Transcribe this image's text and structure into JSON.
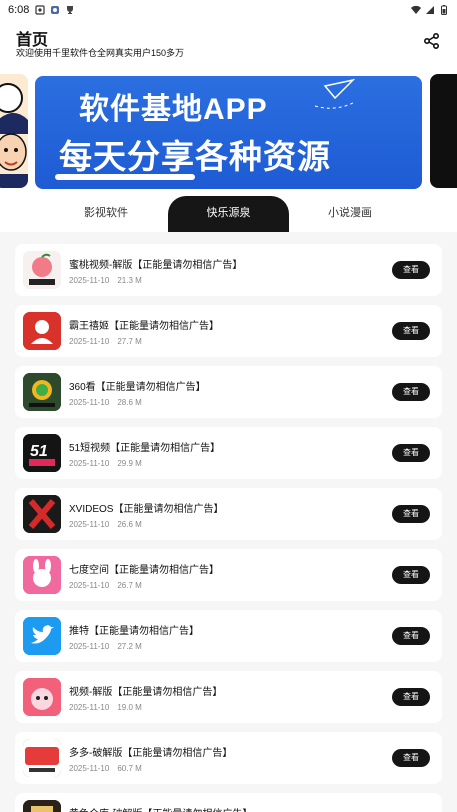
{
  "status": {
    "time": "6:08"
  },
  "header": {
    "title": "首页",
    "subtitle": "欢迎使用千里软件仓全网真实用户150多万"
  },
  "banner": {
    "line1": "软件基地APP",
    "line2": "每天分享各种资源"
  },
  "tabs": [
    {
      "label": "影视软件",
      "active": false
    },
    {
      "label": "快乐源泉",
      "active": true
    },
    {
      "label": "小说漫画",
      "active": false
    }
  ],
  "apps": [
    {
      "name": "蜜桃视频-解版【正能量请勿相信广告】",
      "date": "2025-11-10",
      "size": "21.3 M",
      "button": "查看",
      "icon": "peach-app-icon",
      "color": "#f7f0f0"
    },
    {
      "name": "霸王禧姬【正能量请勿相信广告】",
      "date": "2025-11-10",
      "size": "27.7 M",
      "button": "查看",
      "icon": "bawang-app-icon",
      "color": "#d8322a"
    },
    {
      "name": "360看【正能量请勿相信广告】",
      "date": "2025-11-10",
      "size": "28.6 M",
      "button": "查看",
      "icon": "360-app-icon",
      "color": "#2e4a2c"
    },
    {
      "name": "51短视频【正能量请勿相信广告】",
      "date": "2025-11-10",
      "size": "29.9 M",
      "button": "查看",
      "icon": "51-app-icon",
      "color": "#141414"
    },
    {
      "name": "XVIDEOS【正能量请勿相信广告】",
      "date": "2025-11-10",
      "size": "26.6 M",
      "button": "查看",
      "icon": "xvideos-app-icon",
      "color": "#1a1a1a"
    },
    {
      "name": "七度空间【正能量请勿相信广告】",
      "date": "2025-11-10",
      "size": "26.7 M",
      "button": "查看",
      "icon": "qidu-app-icon",
      "color": "#f06aa0"
    },
    {
      "name": "推特【正能量请勿相信广告】",
      "date": "2025-11-10",
      "size": "27.2 M",
      "button": "查看",
      "icon": "twitter-app-icon",
      "color": "#1d9bf0"
    },
    {
      "name": "视频-解版【正能量请勿相信广告】",
      "date": "2025-11-10",
      "size": "19.0 M",
      "button": "查看",
      "icon": "rabbit-app-icon",
      "color": "#f2607a"
    },
    {
      "name": "多多-破解版【正能量请勿相信广告】",
      "date": "2025-11-10",
      "size": "60.7 M",
      "button": "查看",
      "icon": "duoduo-app-icon",
      "color": "#e53b3b"
    },
    {
      "name": "黄色仓库-破解版【正能量请勿相信广告】",
      "date": "",
      "size": "",
      "button": "",
      "icon": "huangse-app-icon",
      "color": "#2a2118"
    }
  ]
}
